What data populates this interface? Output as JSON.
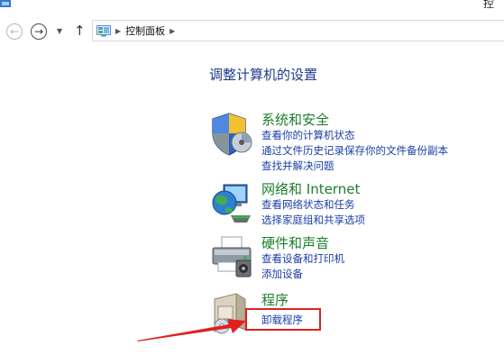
{
  "window": {
    "title_fragment": "控"
  },
  "nav": {
    "back_icon": "back-arrow-icon",
    "forward_icon": "forward-arrow-icon",
    "up_icon": "up-arrow-icon"
  },
  "address": {
    "breadcrumbs": [
      "控制面板"
    ]
  },
  "main": {
    "title": "调整计算机的设置",
    "categories": [
      {
        "title": "系统和安全",
        "icon": "shield-icon",
        "links": [
          "查看你的计算机状态",
          "通过文件历史记录保存你的文件备份副本",
          "查找并解决问题"
        ]
      },
      {
        "title": "网络和 Internet",
        "icon": "network-globe-icon",
        "links": [
          "查看网络状态和任务",
          "选择家庭组和共享选项"
        ]
      },
      {
        "title": "硬件和声音",
        "icon": "printer-icon",
        "links": [
          "查看设备和打印机",
          "添加设备"
        ]
      },
      {
        "title": "程序",
        "icon": "programs-icon",
        "links": [
          "卸载程序"
        ]
      }
    ]
  },
  "colors": {
    "title_blue": "#1e3a8a",
    "category_green": "#1d7e2c",
    "link_blue": "#1a3fa8",
    "highlight_red": "#e02020"
  }
}
